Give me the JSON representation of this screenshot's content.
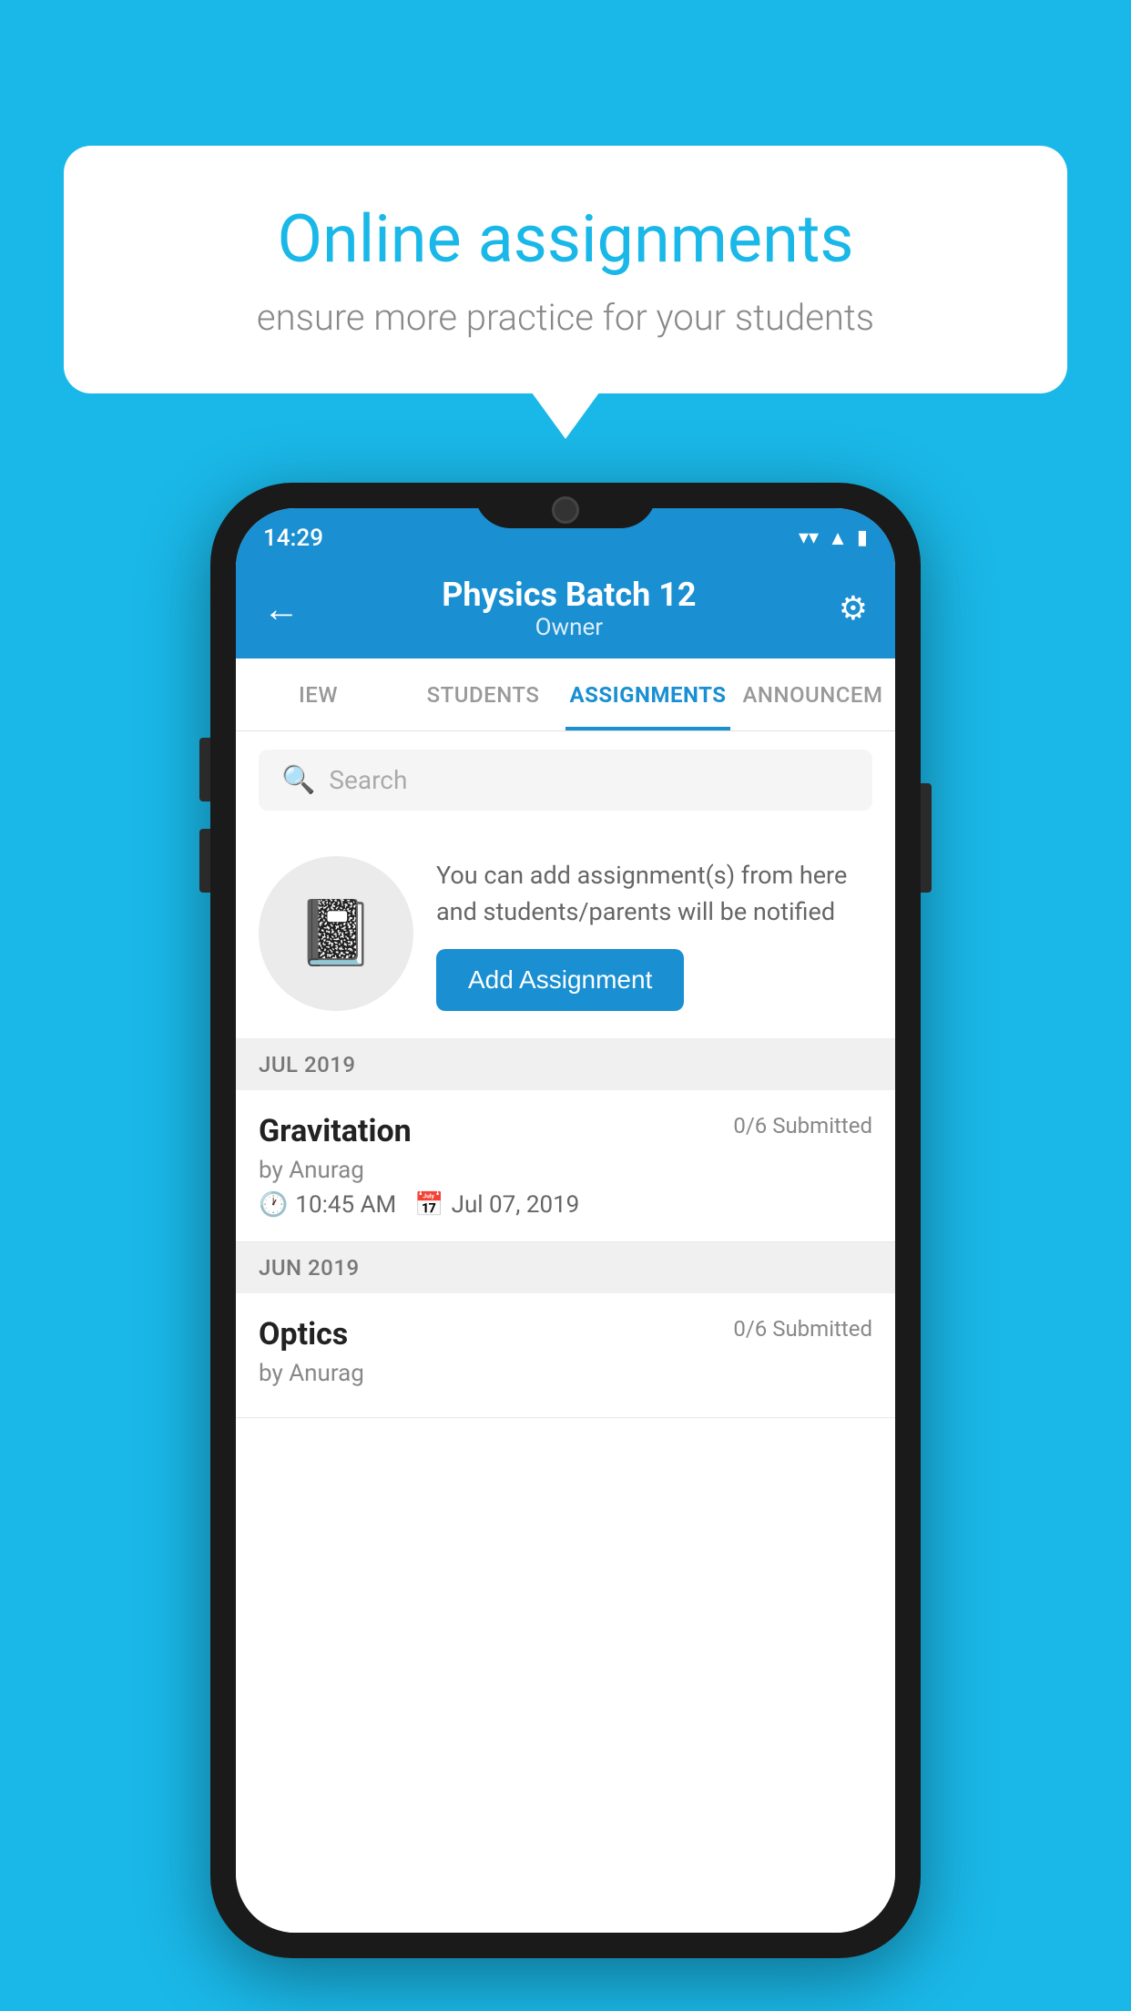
{
  "background_color": "#1ab8e8",
  "bubble": {
    "title": "Online assignments",
    "subtitle": "ensure more practice for your students"
  },
  "phone": {
    "status_bar": {
      "time": "14:29",
      "wifi_icon": "▼",
      "signal_icon": "▲",
      "battery_icon": "▮"
    },
    "header": {
      "back_label": "←",
      "title": "Physics Batch 12",
      "subtitle": "Owner",
      "settings_label": "⚙"
    },
    "tabs": [
      {
        "label": "IEW",
        "active": false
      },
      {
        "label": "STUDENTS",
        "active": false
      },
      {
        "label": "ASSIGNMENTS",
        "active": true
      },
      {
        "label": "ANNOUNCEM",
        "active": false
      }
    ],
    "search": {
      "placeholder": "Search"
    },
    "empty_state": {
      "description": "You can add assignment(s) from here and students/parents will be notified",
      "button_label": "Add Assignment"
    },
    "sections": [
      {
        "label": "JUL 2019",
        "assignments": [
          {
            "name": "Gravitation",
            "submitted": "0/6 Submitted",
            "by": "by Anurag",
            "time": "10:45 AM",
            "date": "Jul 07, 2019"
          }
        ]
      },
      {
        "label": "JUN 2019",
        "assignments": [
          {
            "name": "Optics",
            "submitted": "0/6 Submitted",
            "by": "by Anurag",
            "time": "",
            "date": ""
          }
        ]
      }
    ]
  }
}
